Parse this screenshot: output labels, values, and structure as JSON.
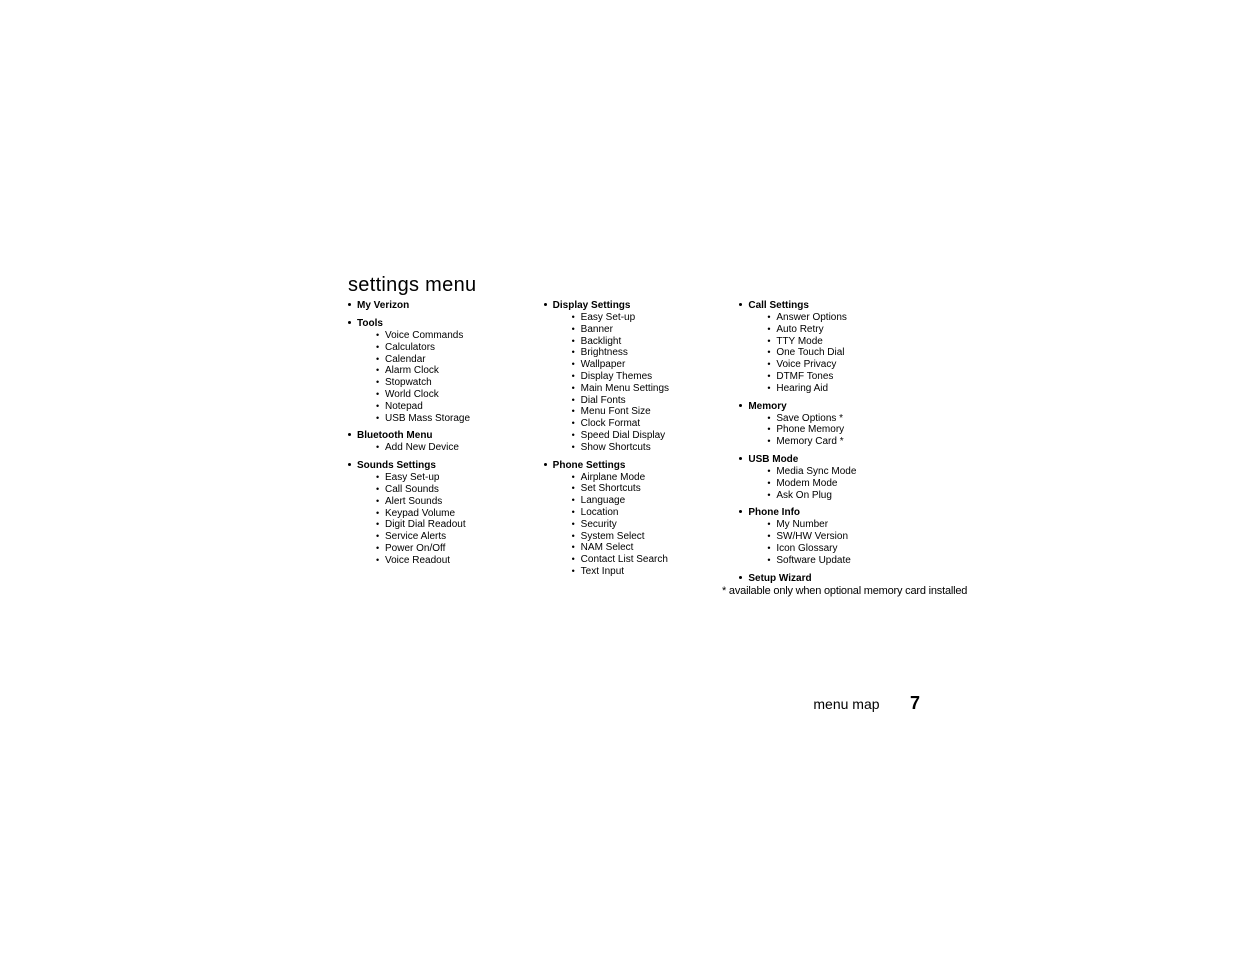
{
  "title": "settings menu",
  "columns": [
    [
      {
        "header": "My Verizon",
        "items": []
      },
      {
        "header": "Tools",
        "items": [
          "Voice Commands",
          "Calculators",
          "Calendar",
          "Alarm Clock",
          "Stopwatch",
          "World Clock",
          "Notepad",
          "USB Mass Storage"
        ]
      },
      {
        "header": "Bluetooth Menu",
        "items": [
          "Add New Device"
        ]
      },
      {
        "header": "Sounds Settings",
        "items": [
          "Easy Set-up",
          "Call Sounds",
          "Alert Sounds",
          "Keypad Volume",
          "Digit Dial Readout",
          "Service Alerts",
          "Power On/Off",
          "Voice Readout"
        ]
      }
    ],
    [
      {
        "header": "Display Settings",
        "items": [
          "Easy Set-up",
          "Banner",
          "Backlight",
          "Brightness",
          "Wallpaper",
          "Display Themes",
          "Main Menu Settings",
          "Dial Fonts",
          "Menu Font Size",
          "Clock Format",
          "Speed Dial Display",
          "Show Shortcuts"
        ]
      },
      {
        "header": "Phone Settings",
        "items": [
          "Airplane Mode",
          "Set Shortcuts",
          "Language",
          "Location",
          "Security",
          "System Select",
          "NAM Select",
          "Contact List Search",
          "Text Input"
        ]
      }
    ],
    [
      {
        "header": "Call Settings",
        "items": [
          "Answer Options",
          "Auto Retry",
          "TTY Mode",
          "One Touch Dial",
          "Voice Privacy",
          "DTMF Tones",
          "Hearing Aid"
        ]
      },
      {
        "header": "Memory",
        "items": [
          "Save Options *",
          "Phone Memory",
          "Memory Card *"
        ]
      },
      {
        "header": "USB Mode",
        "items": [
          "Media Sync Mode",
          "Modem Mode",
          "Ask On Plug"
        ]
      },
      {
        "header": "Phone Info",
        "items": [
          "My Number",
          "SW/HW Version",
          "Icon Glossary",
          "Software Update"
        ]
      },
      {
        "header": "Setup Wizard",
        "items": []
      }
    ]
  ],
  "footnote": "* available only when optional memory card installed",
  "footer": {
    "section": "menu map",
    "page": "7"
  }
}
